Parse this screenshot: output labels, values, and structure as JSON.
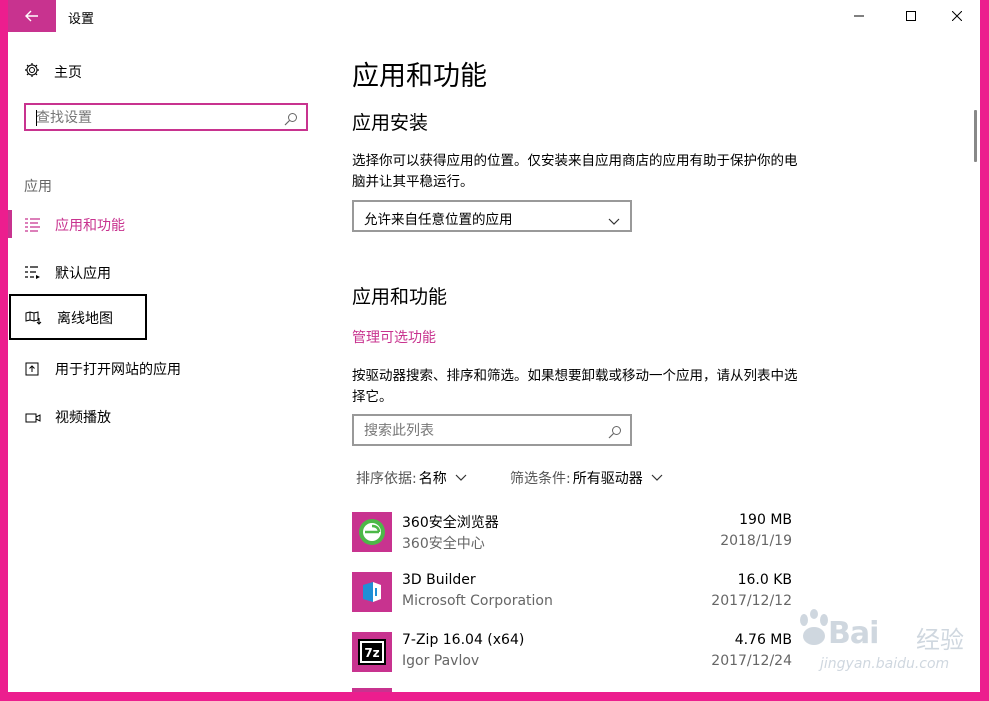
{
  "window": {
    "title": "设置"
  },
  "sidebar": {
    "home_label": "主页",
    "search_placeholder": "查找设置",
    "section_label": "应用",
    "items": [
      {
        "label": "应用和功能",
        "icon": "apps-list-icon",
        "active": true
      },
      {
        "label": "默认应用",
        "icon": "default-apps-icon"
      },
      {
        "label": "离线地图",
        "icon": "offline-map-icon",
        "highlighted": true
      },
      {
        "label": "用于打开网站的应用",
        "icon": "app-for-websites-icon"
      },
      {
        "label": "视频播放",
        "icon": "video-icon"
      }
    ]
  },
  "main": {
    "title": "应用和功能",
    "install_heading": "应用安装",
    "install_desc": "选择你可以获得应用的位置。仅安装来自应用商店的应用有助于保护你的电脑并让其平稳运行。",
    "install_dropdown_value": "允许来自任意位置的应用",
    "apps_heading": "应用和功能",
    "manage_optional_link": "管理可选功能",
    "apps_desc": "按驱动器搜索、排序和筛选。如果想要卸载或移动一个应用，请从列表中选择它。",
    "list_search_placeholder": "搜索此列表",
    "sort_label": "排序依据:",
    "sort_value": "名称",
    "filter_label": "筛选条件:",
    "filter_value": "所有驱动器",
    "apps": [
      {
        "name": "360安全浏览器",
        "publisher": "360安全中心",
        "size": "190 MB",
        "date": "2018/1/19",
        "icon": "360-browser-icon"
      },
      {
        "name": "3D Builder",
        "publisher": "Microsoft Corporation",
        "size": "16.0 KB",
        "date": "2017/12/12",
        "icon": "3d-builder-icon"
      },
      {
        "name": "7-Zip 16.04 (x64)",
        "publisher": "Igor Pavlov",
        "size": "4.76 MB",
        "date": "2017/12/24",
        "icon": "7zip-icon"
      }
    ]
  },
  "watermark": {
    "brand": "Bai",
    "brand_cn": "经验",
    "url": "jingyan.baidu.com"
  },
  "colors": {
    "accent": "#c8338f",
    "frame": "#ec1e8e"
  }
}
